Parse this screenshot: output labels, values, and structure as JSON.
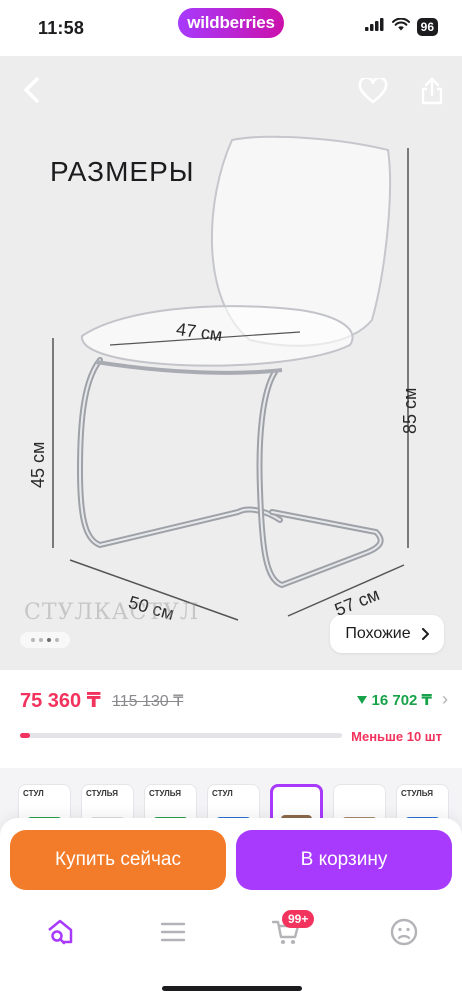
{
  "status_bar": {
    "time": "11:58",
    "battery": "96"
  },
  "brand": {
    "logo_text": "wildberries",
    "accent": "#a73afd"
  },
  "photo": {
    "title": "РАЗМЕРЫ",
    "dimensions": {
      "seat_width": "47 см",
      "height": "85 см",
      "seat_height": "45 см",
      "base_width": "50 см",
      "depth": "57 см"
    },
    "watermark": "СТУЛКАСТУЛ",
    "slide_count": 4,
    "active_slide": 2,
    "similar_label": "Похожие"
  },
  "price": {
    "current": "75 360 ₸",
    "old": "115 130 ₸",
    "points": "16 702 ₸",
    "current_color": "#f2335d",
    "points_color": "#17a34a"
  },
  "stock": {
    "label": "Меньше 10 шт",
    "fill_fraction": 0.03
  },
  "variants": [
    {
      "label": "СТУЛ",
      "swatch": "#2f9d46",
      "selected": false
    },
    {
      "label": "СТУЛЬЯ",
      "swatch": "#d9d9dc",
      "selected": false
    },
    {
      "label": "СТУЛЬЯ",
      "swatch": "#2f9d46",
      "selected": false
    },
    {
      "label": "СТУЛ",
      "swatch": "#2a6fd6",
      "selected": false
    },
    {
      "label": "",
      "swatch": "#8b6a4a",
      "selected": true
    },
    {
      "label": "",
      "swatch": "#a6896a",
      "selected": false
    },
    {
      "label": "СТУЛЬЯ",
      "swatch": "#2a6fd6",
      "selected": false
    }
  ],
  "actions": {
    "buy_now": "Купить сейчас",
    "add_to_cart": "В корзину"
  },
  "tabbar": {
    "cart_badge": "99+",
    "icons": [
      "home-search-icon",
      "menu-icon",
      "cart-icon",
      "profile-icon"
    ]
  }
}
